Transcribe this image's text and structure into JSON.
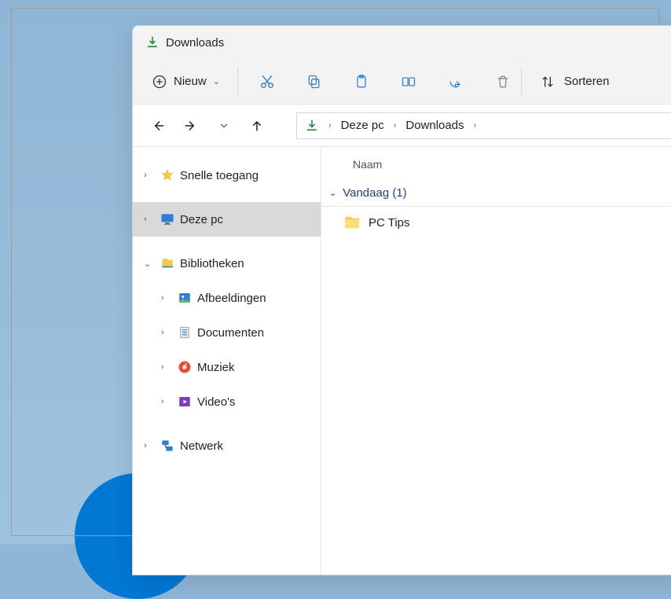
{
  "title": "Downloads",
  "toolbar": {
    "new_label": "Nieuw",
    "sort_label": "Sorteren"
  },
  "breadcrumb": {
    "root": "Deze pc",
    "folder": "Downloads"
  },
  "sidebar": {
    "quick_access": "Snelle toegang",
    "this_pc": "Deze pc",
    "libraries": "Bibliotheken",
    "pictures": "Afbeeldingen",
    "documents": "Documenten",
    "music": "Muziek",
    "videos": "Video's",
    "network": "Netwerk"
  },
  "main": {
    "col_name": "Naam",
    "group_today": "Vandaag (1)",
    "item1": "PC Tips"
  }
}
